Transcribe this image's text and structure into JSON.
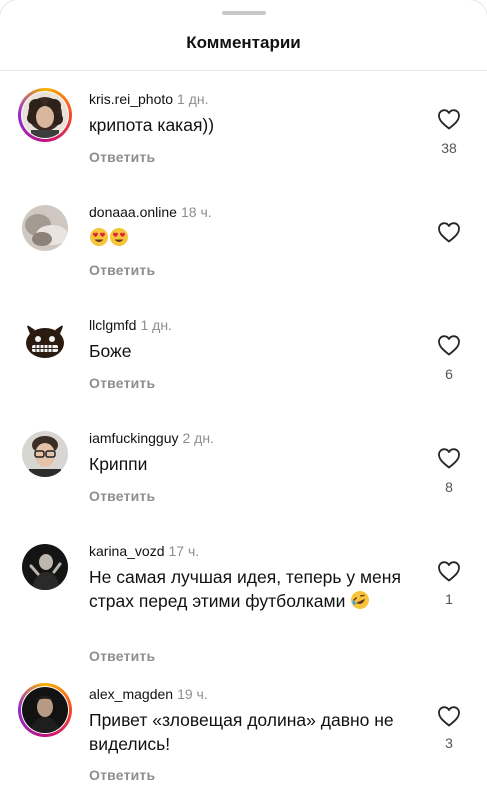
{
  "header": {
    "title": "Комментарии"
  },
  "comments": [
    {
      "username": "kris.rei_photo",
      "time": "1 дн.",
      "text": "крипота какая))",
      "reply": "Ответить",
      "likes": "38",
      "story_ring": true,
      "avatar": "avatar-curly-hair"
    },
    {
      "username": "donaaa.online",
      "time": "18 ч.",
      "text": "",
      "emoji": [
        "heart-eyes-emoji",
        "heart-eyes-emoji"
      ],
      "reply": "Ответить",
      "likes": "",
      "story_ring": false,
      "avatar": "avatar-grey-photo"
    },
    {
      "username": "llclgmfd",
      "time": "1 дн.",
      "text": "Боже",
      "reply": "Ответить",
      "likes": "6",
      "story_ring": false,
      "avatar": "avatar-monster"
    },
    {
      "username": "iamfuckingguy",
      "time": "2 дн.",
      "text": "Криппи",
      "reply": "Ответить",
      "likes": "8",
      "story_ring": false,
      "avatar": "avatar-glasses-man"
    },
    {
      "username": "karina_vozd",
      "time": "17 ч.",
      "text": "Не самая лучшая идея, теперь у меня страх перед этими футболками",
      "emoji": [
        "rolling-laughing-emoji"
      ],
      "reply": "Ответить",
      "likes": "1",
      "story_ring": false,
      "avatar": "avatar-dark-figure"
    },
    {
      "username": "alex_magden",
      "time": "19 ч.",
      "text": "Привет «зловещая долина» давно не виделись!",
      "reply": "Ответить",
      "likes": "3",
      "story_ring": true,
      "avatar": "avatar-dark-portrait"
    }
  ],
  "colors": {
    "story_ring": "#d92b7e",
    "muted_text": "#8e8e8e",
    "background": "#ffffff"
  }
}
